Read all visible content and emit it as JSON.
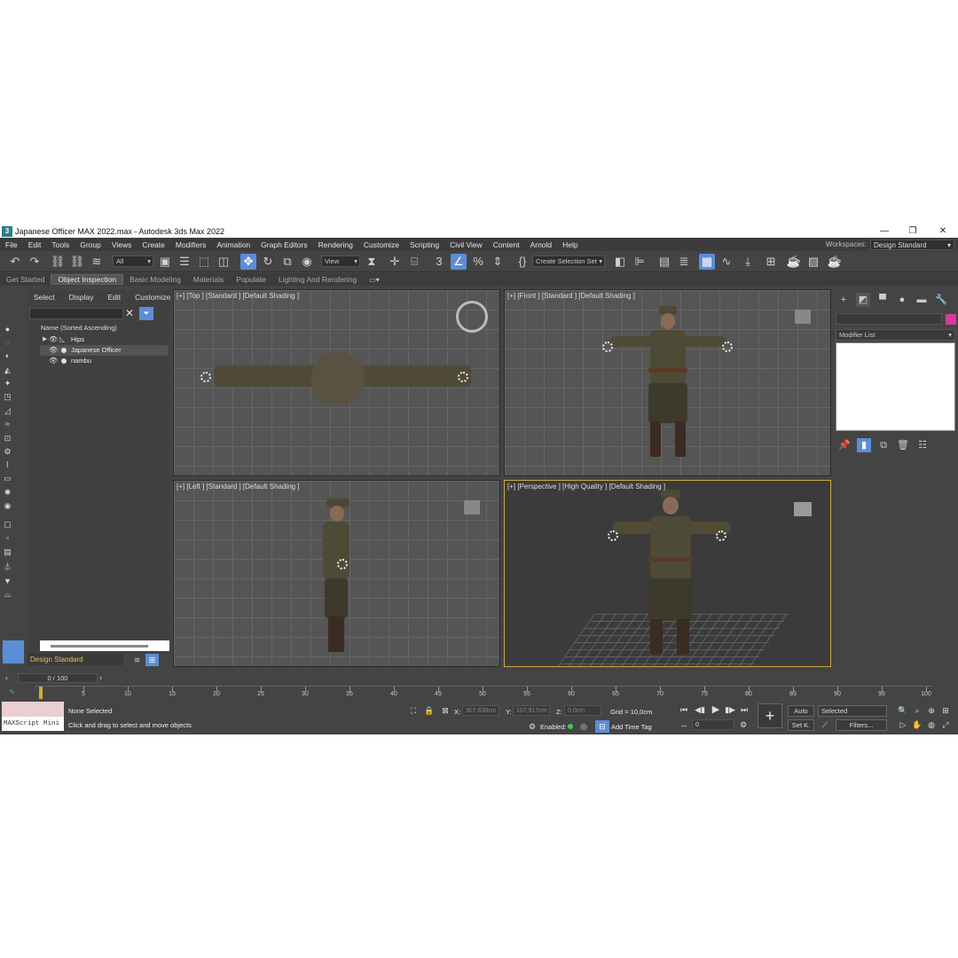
{
  "window": {
    "title": "Japanese Officer MAX 2022.max - Autodesk 3ds Max 2022",
    "minimize": "—",
    "maximize": "❐",
    "close": "✕"
  },
  "menu": [
    "File",
    "Edit",
    "Tools",
    "Group",
    "Views",
    "Create",
    "Modifiers",
    "Animation",
    "Graph Editors",
    "Rendering",
    "Customize",
    "Scripting",
    "Civil View",
    "Content",
    "Arnold",
    "Help"
  ],
  "workspaces": {
    "label": "Workspaces:",
    "value": "Design Standard"
  },
  "toolbar": {
    "filter_value": "All",
    "refcoord_value": "View",
    "selection_set": "Create Selection Set"
  },
  "ribbon": {
    "tabs": [
      "Get Started",
      "Object Inspection",
      "Basic Modeling",
      "Materials",
      "Populate",
      "Lighting And Rendering"
    ],
    "active": "Object Inspection"
  },
  "scene_explorer": {
    "tabs": [
      "Select",
      "Display",
      "Edit",
      "Customize"
    ],
    "column_header": "Name (Sorted Ascending)",
    "items": [
      {
        "label": "Hips",
        "selected": false
      },
      {
        "label": "Japanese Officer",
        "selected": true
      },
      {
        "label": "nambu",
        "selected": false
      }
    ],
    "workspace_value": "Design Standard"
  },
  "viewports": {
    "top": "[+] [Top ] [Standard ] [Default Shading ]",
    "front": "[+] [Front ] [Standard ] [Default Shading ]",
    "left": "[+] [Left ] [Standard ] [Default Shading ]",
    "perspective": "[+] [Perspective ] [High Quality ] [Default Shading ]"
  },
  "command_panel": {
    "modifier_list": "Modifier List"
  },
  "timeline": {
    "frame_display": "0 / 100",
    "ticks": [
      "0",
      "5",
      "10",
      "15",
      "20",
      "25",
      "30",
      "35",
      "40",
      "45",
      "50",
      "55",
      "60",
      "65",
      "70",
      "75",
      "80",
      "85",
      "90",
      "95",
      "100"
    ]
  },
  "status": {
    "maxscript": "MAXScript Mini",
    "selection": "None Selected",
    "prompt": "Click and drag to select and move objects",
    "x_label": "X:",
    "x_value": "307,638cm",
    "y_label": "Y:",
    "y_value": "107,917cm",
    "z_label": "Z:",
    "z_value": "0,0cm",
    "grid": "Grid = 10,0cm",
    "enabled_label": "Enabled:",
    "add_time_tag": "Add Time Tag",
    "auto_key": "Auto",
    "set_key": "Set K.",
    "key_filter_value": "Selected",
    "filters": "Filters...",
    "frame_value": "0"
  }
}
